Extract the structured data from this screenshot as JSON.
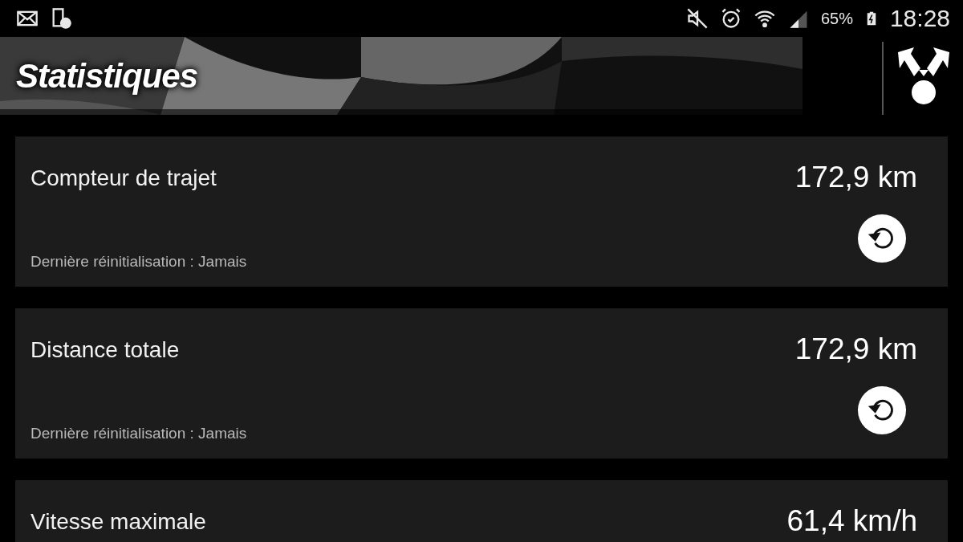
{
  "status_bar": {
    "battery": "65%",
    "time": "18:28"
  },
  "header": {
    "title": "Statistiques"
  },
  "stats": [
    {
      "kind": "resettable",
      "title": "Compteur de trajet",
      "value": "172,9 km",
      "subtitle": "Dernière réinitialisation : Jamais"
    },
    {
      "kind": "resettable",
      "title": "Distance totale",
      "value": "172,9 km",
      "subtitle": "Dernière réinitialisation : Jamais"
    },
    {
      "kind": "plain",
      "title": "Vitesse maximale",
      "value": "61,4 km/h"
    }
  ]
}
